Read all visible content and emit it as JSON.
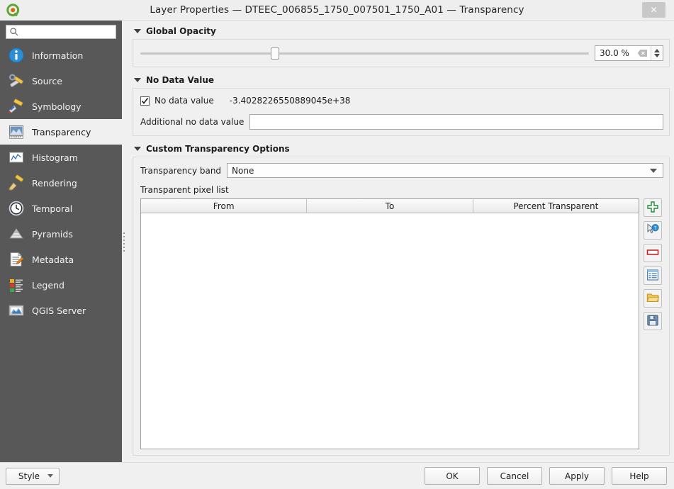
{
  "window": {
    "title": "Layer Properties — DTEEC_006855_1750_007501_1750_A01 — Transparency",
    "logo_icon": "qgis-logo-icon",
    "close_label": "✕"
  },
  "sidebar": {
    "search": {
      "value": "",
      "placeholder": "",
      "icon": "search-icon"
    },
    "items": [
      {
        "label": "Information",
        "icon": "information-icon",
        "selected": false
      },
      {
        "label": "Source",
        "icon": "source-icon",
        "selected": false
      },
      {
        "label": "Symbology",
        "icon": "symbology-icon",
        "selected": false
      },
      {
        "label": "Transparency",
        "icon": "transparency-icon",
        "selected": true
      },
      {
        "label": "Histogram",
        "icon": "histogram-icon",
        "selected": false
      },
      {
        "label": "Rendering",
        "icon": "rendering-icon",
        "selected": false
      },
      {
        "label": "Temporal",
        "icon": "temporal-icon",
        "selected": false
      },
      {
        "label": "Pyramids",
        "icon": "pyramids-icon",
        "selected": false
      },
      {
        "label": "Metadata",
        "icon": "metadata-icon",
        "selected": false
      },
      {
        "label": "Legend",
        "icon": "legend-icon",
        "selected": false
      },
      {
        "label": "QGIS Server",
        "icon": "qgis-server-icon",
        "selected": false
      }
    ]
  },
  "global_opacity": {
    "title": "Global Opacity",
    "slider_percent": 30,
    "spin_value": "30.0 %",
    "clear_icon": "clear-icon",
    "spin_up_icon": "spin-up-icon",
    "spin_down_icon": "spin-down-icon"
  },
  "no_data_value": {
    "title": "No Data Value",
    "checkbox_label": "No data value",
    "checkbox_checked": true,
    "value": "-3.4028226550889045e+38",
    "additional_label": "Additional no data value",
    "additional_value": "",
    "additional_placeholder": ""
  },
  "custom_transparency": {
    "title": "Custom Transparency Options",
    "band_label": "Transparency band",
    "band_value": "None",
    "band_options": [
      "None"
    ],
    "pixel_list_label": "Transparent pixel list",
    "columns": [
      "From",
      "To",
      "Percent Transparent"
    ],
    "rows": [],
    "tools": [
      {
        "name": "add-values-manually-button",
        "icon": "green-plus-icon"
      },
      {
        "name": "add-values-from-display-button",
        "icon": "cursor-query-icon"
      },
      {
        "name": "remove-selected-row-button",
        "icon": "red-minus-icon"
      },
      {
        "name": "default-values-button",
        "icon": "table-icon"
      },
      {
        "name": "import-from-file-button",
        "icon": "folder-open-icon"
      },
      {
        "name": "export-to-file-button",
        "icon": "floppy-save-icon"
      }
    ]
  },
  "footer": {
    "style_label": "Style",
    "buttons": [
      {
        "label": "OK",
        "name": "ok-button"
      },
      {
        "label": "Cancel",
        "name": "cancel-button"
      },
      {
        "label": "Apply",
        "name": "apply-button"
      },
      {
        "label": "Help",
        "name": "help-button"
      }
    ]
  },
  "colors": {
    "sidebar_bg": "#585858",
    "panel_bg": "#f0f0f0",
    "selected_item_bg": "#f0f0f0",
    "accent_green": "#2e9e3e",
    "accent_red": "#d02020"
  }
}
